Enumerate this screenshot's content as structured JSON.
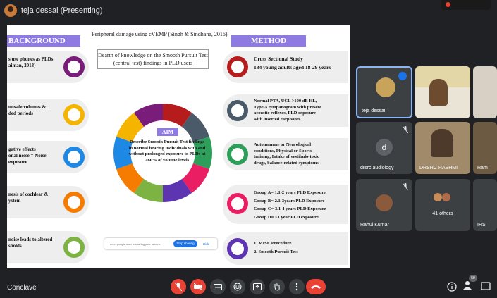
{
  "top_bar": {
    "presenter_label": "teja dessai (Presenting)"
  },
  "slide": {
    "title": "Peripheral damage using cVEMP (Singh & Sindhana, 2016)",
    "background_header": "BACKGROUND",
    "method_header": "METHOD",
    "gap_box": [
      "Dearth of knowledge on the Smooth Pursuit Test",
      "(central test) findings in PLD users"
    ],
    "background_items": [
      {
        "lines": [
          "s use phones as PLDs",
          "aiman, 2013)"
        ],
        "color": "#7a1c7a"
      },
      {
        "lines": [
          "unsafe volumes &",
          "ded periods"
        ],
        "color": "#f4b400"
      },
      {
        "lines": [
          "gative effects",
          "onal noise = Noise",
          "exposure"
        ],
        "color": "#1e88e5"
      },
      {
        "lines": [
          "nesis of cochlear &",
          "ystem"
        ],
        "color": "#f57c00"
      },
      {
        "lines": [
          "noise leads to altered",
          "sholds"
        ],
        "color": "#7cb342"
      }
    ],
    "method_items": [
      {
        "lines": [
          "Cross Sectional Study",
          "134 young adults aged 18-29 years"
        ],
        "color": "#b71c1c"
      },
      {
        "lines": [
          "Normal PTA, UCL >100 dB HL,",
          "Type A tympanogram with present",
          "acoustic reflexes, PLD exposure",
          "with inserted earphones"
        ],
        "color": "#4a5a68"
      },
      {
        "lines": [
          "Autoimmune or Neurological",
          "conditions, Physical or Sports",
          "training, Intake of vestibulo-toxic",
          "drugs, balance-related symptoms"
        ],
        "color": "#2e9e5b"
      },
      {
        "lines": [
          "Group A= 1.1-2 years PLD Exposure",
          "Group B= 2.1-3years PLD Exposure",
          "Group C= 3.1-4 years PLD Exposure",
          "Group D= <1 year PLD exposure"
        ],
        "color": "#e91e63"
      },
      {
        "lines": [
          "1.   MISE Procedure",
          "2.   Smooth Pursuit Test"
        ],
        "color": "#5e35b1"
      }
    ],
    "aim": {
      "label": "AIM",
      "text": "Describe Smooth Pursuit Test findings in normal hearing individuals with and without prolonged exposure to PLDs at >60% of volume levels"
    },
    "share_bar": {
      "text": "meet.google.com is sharing your screen.",
      "stop_label": "Stop sharing",
      "hide_label": "Hide"
    }
  },
  "participants": {
    "tiles": [
      {
        "name": "teja dessai"
      },
      {
        "name": ""
      },
      {
        "name": ""
      },
      {
        "name": "drsrc audiology",
        "avatar_letter": "d"
      },
      {
        "name": "DRSRC RASHMI"
      },
      {
        "name": "Ram"
      },
      {
        "name": "Rahul Kumar"
      },
      {
        "name": "41 others"
      },
      {
        "name": "IHS"
      }
    ]
  },
  "bottom_bar": {
    "meeting_name": "Conclave",
    "participant_count": "50"
  },
  "colors": {
    "background": "#202124",
    "tile": "#3c4043",
    "accent_red": "#ea4335",
    "accent_blue": "#1a73e8",
    "slide_header": "#8e7ae0"
  }
}
